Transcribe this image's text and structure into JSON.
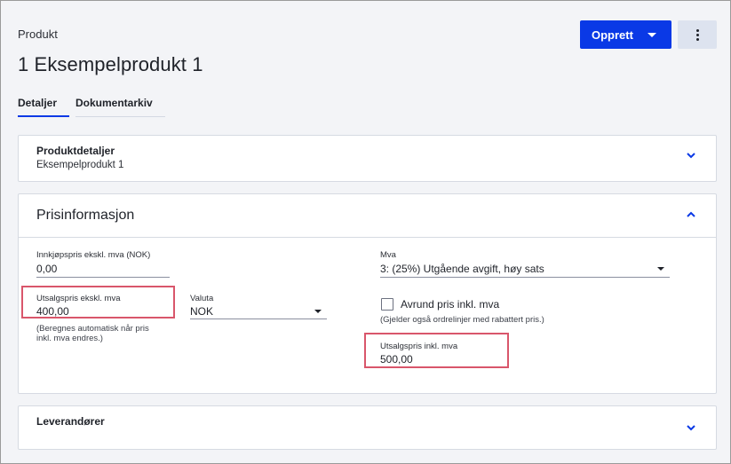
{
  "header": {
    "subtitle": "Produkt",
    "title": "1 Eksempelprodukt 1",
    "create_button": "Opprett"
  },
  "tabs": [
    {
      "label": "Detaljer",
      "active": true
    },
    {
      "label": "Dokumentarkiv",
      "active": false
    }
  ],
  "produktdetaljer": {
    "title": "Produktdetaljer",
    "subtitle": "Eksempelprodukt 1"
  },
  "prisinformasjon": {
    "title": "Prisinformasjon",
    "innkjopspris": {
      "label": "Innkjøpspris ekskl. mva (NOK)",
      "value": "0,00"
    },
    "utsalgspris_ekskl": {
      "label": "Utsalgspris ekskl. mva",
      "value": "400,00"
    },
    "auto_hint_line1": "(Beregnes automatisk når pris",
    "auto_hint_line2": "inkl. mva endres.)",
    "valuta": {
      "label": "Valuta",
      "value": "NOK"
    },
    "mva": {
      "label": "Mva",
      "value": "3: (25%) Utgående avgift, høy sats"
    },
    "avrund": {
      "label": "Avrund pris inkl. mva",
      "checked": false
    },
    "avrund_hint": "(Gjelder også ordrelinjer med rabattert pris.)",
    "utsalgspris_inkl": {
      "label": "Utsalgspris inkl. mva",
      "value": "500,00"
    }
  },
  "leverandorer": {
    "title": "Leverandører"
  },
  "colors": {
    "primary": "#0a39e6",
    "highlight": "#d9566b"
  }
}
